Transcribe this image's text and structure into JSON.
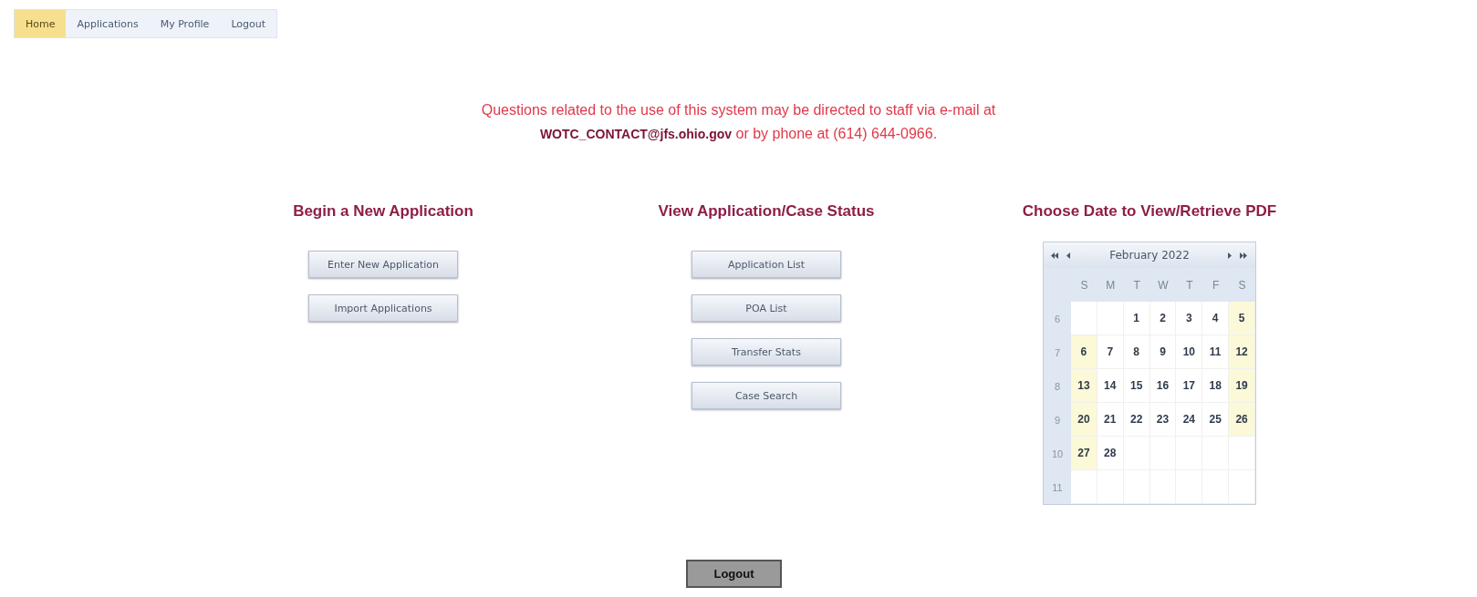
{
  "nav": [
    {
      "label": "Home",
      "selected": true
    },
    {
      "label": "Applications",
      "selected": false
    },
    {
      "label": "My Profile",
      "selected": false
    },
    {
      "label": "Logout",
      "selected": false
    }
  ],
  "notice": {
    "line1": "Questions related to the use of this system may be directed to staff via e-mail at",
    "email": "WOTC_CONTACT@jfs.ohio.gov",
    "line2": " or by phone at (614) 644-0966."
  },
  "sections": [
    {
      "kind": "buttons",
      "title": "Begin a New Application",
      "buttons": [
        "Enter New Application",
        "Import Applications"
      ]
    },
    {
      "kind": "buttons",
      "title": "View Application/Case Status",
      "buttons": [
        "Application List",
        "POA List",
        "Transfer Stats",
        "Case Search"
      ]
    },
    {
      "kind": "calendar",
      "title": "Choose Date to View/Retrieve PDF",
      "calendar": {
        "month": "February 2022",
        "weekdays": [
          "S",
          "M",
          "T",
          "W",
          "T",
          "F",
          "S"
        ],
        "weeks": [
          {
            "number": "6",
            "days": [
              {
                "kind": "blank"
              },
              {
                "kind": "blank"
              },
              {
                "kind": "day",
                "day": "1",
                "weekend": false
              },
              {
                "kind": "day",
                "day": "2",
                "weekend": false
              },
              {
                "kind": "day",
                "day": "3",
                "weekend": false
              },
              {
                "kind": "day",
                "day": "4",
                "weekend": false
              },
              {
                "kind": "day",
                "day": "5",
                "weekend": true
              }
            ]
          },
          {
            "number": "7",
            "days": [
              {
                "kind": "day",
                "day": "6",
                "weekend": true
              },
              {
                "kind": "day",
                "day": "7",
                "weekend": false
              },
              {
                "kind": "day",
                "day": "8",
                "weekend": false
              },
              {
                "kind": "day",
                "day": "9",
                "weekend": false
              },
              {
                "kind": "day",
                "day": "10",
                "weekend": false
              },
              {
                "kind": "day",
                "day": "11",
                "weekend": false
              },
              {
                "kind": "day",
                "day": "12",
                "weekend": true
              }
            ]
          },
          {
            "number": "8",
            "days": [
              {
                "kind": "day",
                "day": "13",
                "weekend": true
              },
              {
                "kind": "day",
                "day": "14",
                "weekend": false
              },
              {
                "kind": "day",
                "day": "15",
                "weekend": false
              },
              {
                "kind": "day",
                "day": "16",
                "weekend": false
              },
              {
                "kind": "day",
                "day": "17",
                "weekend": false
              },
              {
                "kind": "day",
                "day": "18",
                "weekend": false
              },
              {
                "kind": "day",
                "day": "19",
                "weekend": true
              }
            ]
          },
          {
            "number": "9",
            "days": [
              {
                "kind": "day",
                "day": "20",
                "weekend": true
              },
              {
                "kind": "day",
                "day": "21",
                "weekend": false
              },
              {
                "kind": "day",
                "day": "22",
                "weekend": false
              },
              {
                "kind": "day",
                "day": "23",
                "weekend": false
              },
              {
                "kind": "day",
                "day": "24",
                "weekend": false
              },
              {
                "kind": "day",
                "day": "25",
                "weekend": false
              },
              {
                "kind": "day",
                "day": "26",
                "weekend": true
              }
            ]
          },
          {
            "number": "10",
            "days": [
              {
                "kind": "day",
                "day": "27",
                "weekend": true
              },
              {
                "kind": "day",
                "day": "28",
                "weekend": false
              },
              {
                "kind": "blank"
              },
              {
                "kind": "blank"
              },
              {
                "kind": "blank"
              },
              {
                "kind": "blank"
              },
              {
                "kind": "blank"
              }
            ]
          },
          {
            "number": "11",
            "days": [
              {
                "kind": "blank"
              },
              {
                "kind": "blank"
              },
              {
                "kind": "blank"
              },
              {
                "kind": "blank"
              },
              {
                "kind": "blank"
              },
              {
                "kind": "blank"
              },
              {
                "kind": "blank"
              }
            ]
          }
        ]
      }
    }
  ],
  "logout_button": "Logout"
}
